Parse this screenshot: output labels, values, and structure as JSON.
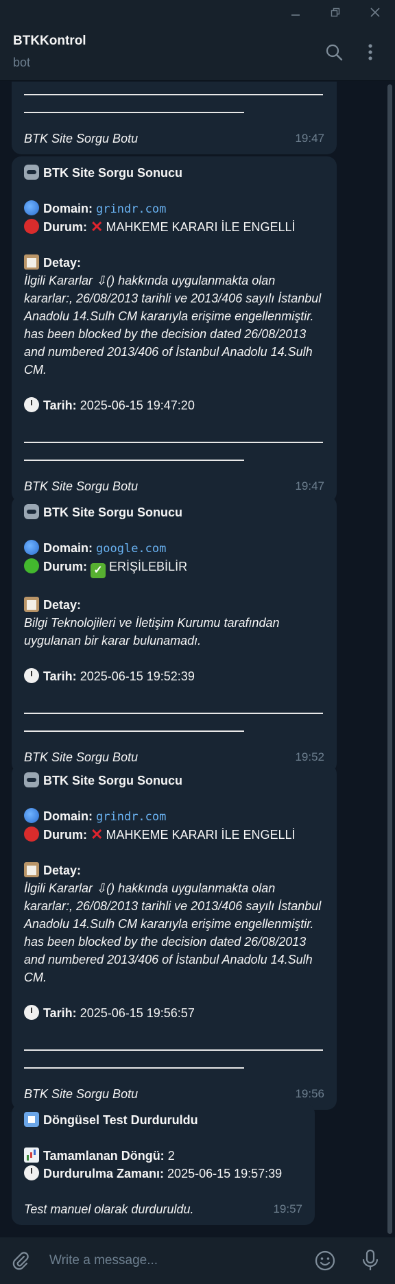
{
  "header": {
    "title": "BTKKontrol",
    "subtitle": "bot"
  },
  "messages": [
    {
      "signature": "BTK Site Sorgu Botu",
      "time": "19:47"
    },
    {
      "title": "BTK Site Sorgu Sonucu",
      "domain_label": "Domain:",
      "domain": "grindr.com",
      "status_label": "Durum:",
      "status": "MAHKEME KARARI İLE ENGELLİ",
      "detail_label": "Detay:",
      "detail": "İlgili Kararlar ⇩() hakkında uygulanmakta olan kararlar:, 26/08/2013 tarihli ve 2013/406 sayılı İstanbul Anadolu 14.Sulh CM kararıyla erişime engellenmiştir. has been blocked by the decision dated 26/08/2013 and numbered 2013/406 of İstanbul Anadolu 14.Sulh CM.",
      "date_label": "Tarih:",
      "date": "2025-06-15 19:47:20",
      "signature": "BTK Site Sorgu Botu",
      "time": "19:47"
    },
    {
      "title": "BTK Site Sorgu Sonucu",
      "domain_label": "Domain:",
      "domain": "google.com",
      "status_label": "Durum:",
      "status": "ERİŞİLEBİLİR",
      "detail_label": "Detay:",
      "detail": "Bilgi Teknolojileri ve İletişim Kurumu tarafından uygulanan bir karar bulunamadı.",
      "date_label": "Tarih:",
      "date": "2025-06-15 19:52:39",
      "signature": "BTK Site Sorgu Botu",
      "time": "19:52"
    },
    {
      "title": "BTK Site Sorgu Sonucu",
      "domain_label": "Domain:",
      "domain": "grindr.com",
      "status_label": "Durum:",
      "status": "MAHKEME KARARI İLE ENGELLİ",
      "detail_label": "Detay:",
      "detail": "İlgili Kararlar ⇩() hakkında uygulanmakta olan kararlar:, 26/08/2013 tarihli ve 2013/406 sayılı İstanbul Anadolu 14.Sulh CM kararıyla erişime engellenmiştir. has been blocked by the decision dated 26/08/2013 and numbered 2013/406 of İstanbul Anadolu 14.Sulh CM.",
      "date_label": "Tarih:",
      "date": "2025-06-15 19:56:57",
      "signature": "BTK Site Sorgu Botu",
      "time": "19:56"
    },
    {
      "title": "Döngüsel Test Durduruldu",
      "cycles_label": "Tamamlanan Döngü:",
      "cycles": "2",
      "stop_label": "Durdurulma Zamanı:",
      "stop_time": "2025-06-15 19:57:39",
      "note": "Test manuel olarak durduruldu.",
      "time": "19:57"
    }
  ],
  "composer": {
    "placeholder": "Write a message..."
  },
  "icons": {
    "minimize": "minimize-icon",
    "restore": "restore-icon",
    "close": "close-icon",
    "search": "search-icon",
    "menu": "more-vertical-icon",
    "attach": "paperclip-icon",
    "emoji": "emoji-icon",
    "voice": "microphone-icon"
  }
}
